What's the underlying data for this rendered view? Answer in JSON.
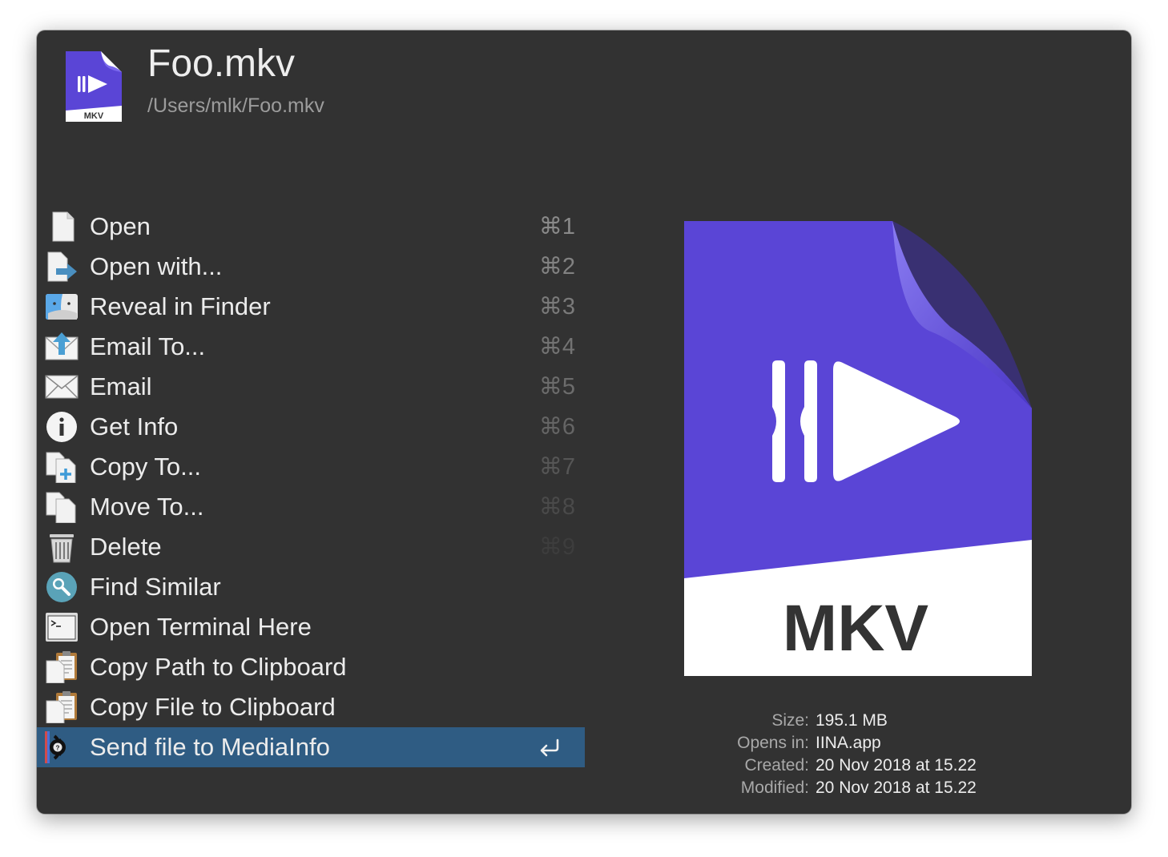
{
  "file": {
    "name": "Foo.mkv",
    "path": "/Users/mlk/Foo.mkv",
    "type_label": "MKV",
    "icon_color": "#5a45d6"
  },
  "actions": [
    {
      "label": "Open",
      "shortcut": "⌘1",
      "icon": "document-icon",
      "shortcut_shade": "#8a8a8a"
    },
    {
      "label": "Open with...",
      "shortcut": "⌘2",
      "icon": "open-with-icon",
      "shortcut_shade": "#828282"
    },
    {
      "label": "Reveal in Finder",
      "shortcut": "⌘3",
      "icon": "finder-icon",
      "shortcut_shade": "#7a7a7a"
    },
    {
      "label": "Email To...",
      "shortcut": "⌘4",
      "icon": "email-to-icon",
      "shortcut_shade": "#737373"
    },
    {
      "label": "Email",
      "shortcut": "⌘5",
      "icon": "envelope-icon",
      "shortcut_shade": "#6c6c6c"
    },
    {
      "label": "Get Info",
      "shortcut": "⌘6",
      "icon": "info-icon",
      "shortcut_shade": "#656565"
    },
    {
      "label": "Copy To...",
      "shortcut": "⌘7",
      "icon": "copy-to-icon",
      "shortcut_shade": "#565656"
    },
    {
      "label": "Move To...",
      "shortcut": "⌘8",
      "icon": "move-to-icon",
      "shortcut_shade": "#4a4a4a"
    },
    {
      "label": "Delete",
      "shortcut": "⌘9",
      "icon": "trash-icon",
      "shortcut_shade": "#3d3d3d"
    },
    {
      "label": "Find Similar",
      "shortcut": "",
      "icon": "magnifier-icon"
    },
    {
      "label": "Open Terminal Here",
      "shortcut": "",
      "icon": "terminal-icon"
    },
    {
      "label": "Copy Path to Clipboard",
      "shortcut": "",
      "icon": "clipboard-icon"
    },
    {
      "label": "Copy File to Clipboard",
      "shortcut": "",
      "icon": "clipboard-icon"
    },
    {
      "label": "Send file to MediaInfo",
      "shortcut": "return",
      "icon": "mediainfo-icon",
      "selected": true
    }
  ],
  "details": [
    {
      "key": "Size:",
      "value": "195.1 MB"
    },
    {
      "key": "Opens in:",
      "value": "IINA.app"
    },
    {
      "key": "Created:",
      "value": "20 Nov 2018 at 15.22"
    },
    {
      "key": "Modified:",
      "value": "20 Nov 2018 at 15.22"
    }
  ],
  "colors": {
    "window_bg": "#323232",
    "selection": "#2f5c83",
    "text": "#ececec",
    "muted": "#9c9c9c"
  }
}
